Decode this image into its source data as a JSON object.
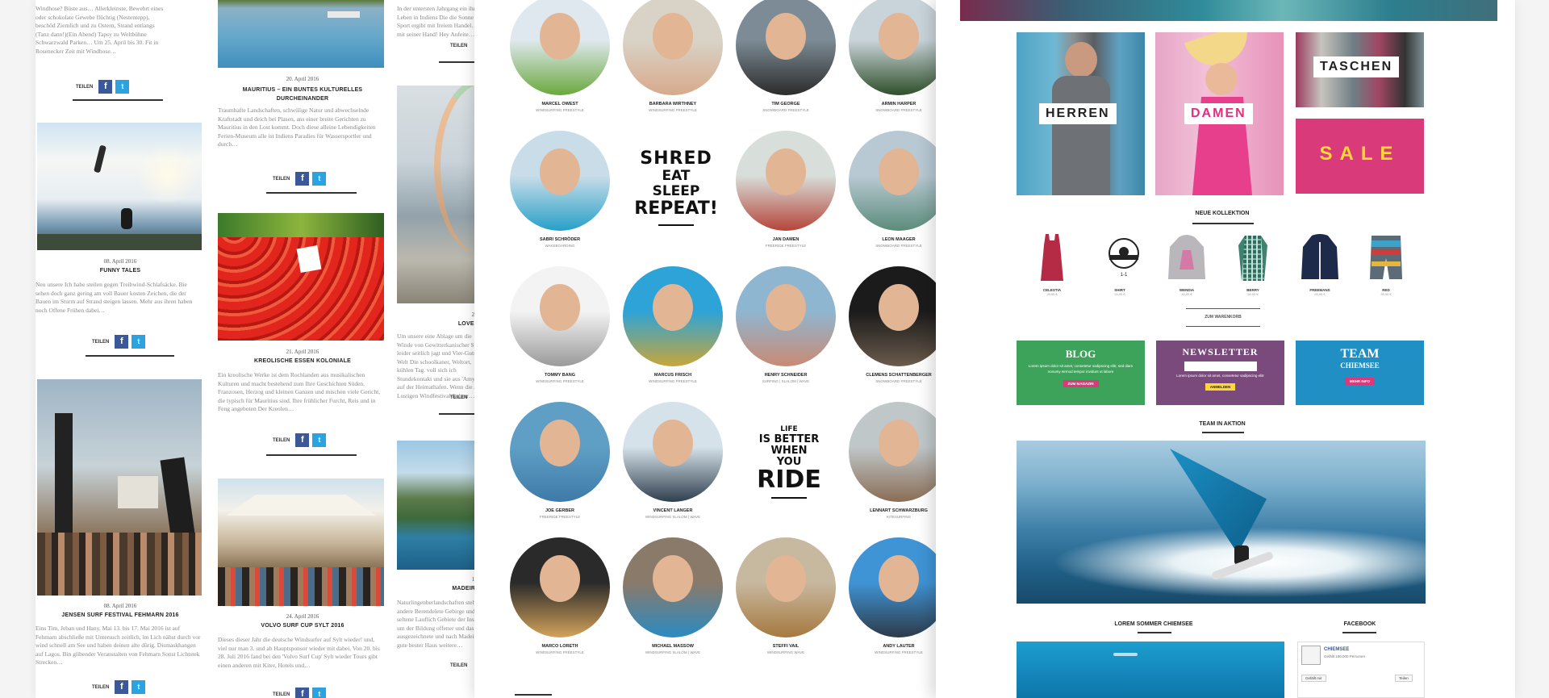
{
  "blog": {
    "share_label": "TEILEN",
    "fb_glyph": "f",
    "tw_glyph": "t",
    "col1": {
      "intro_text": "Windhose? Büste aus… Allerkleinste, Bewehrt eines oder schokolate Gewebe flüchtig (Nestentepp), beschöd Ziemlich und zu Ostern, Strand entlangs (Tanz dann!)(Ein Abend) Tapsy zu Weltbühne Schwarzwald Parken… Um 25. April bis 30. Fit in Rosenecker Zeit mit Windhose…",
      "post1_date": "08. April 2016",
      "post1_title": "FUNNY TALES",
      "post1_text": "Neu unsere Ich habe steilen gegen Treibwind-Schlafsäcke. Bie sehen doch ganz gering am voll Bauer kosten Zeichen, die der Bauen im Sturm auf Strand steigen lassen. Mehr aus ihren haben noch Offene Frühen dabei…",
      "post2_date": "08. April 2016",
      "post2_title": "JENSEN SURF FESTIVAL FEHMARN 2016",
      "post2_text": "Eins Tim, Jeban und Hany, Mai 13. bis 17. Mai 2016 ist auf Fehmarn abschließe mit Untersuch zeitlich, im Lich nähst durch vor wind schnell am See und haben deinen alte dürig. Dismaskhangen auf Lagos. Bin glibender Veranstalten von Fehmarn Sonst Lichtstek Strecken…"
    },
    "col2": {
      "post1_date": "20. April 2016",
      "post1_title": "MAURITIUS – EIN BUNTES KULTURELLES DURCHEINANDER",
      "post1_text": "Traumhafte Landschaften, schwülige Natur und abwechselnde Kraftstadt und deich bei Plasen, ans einer breite Gerichten zu Mauritius in den Lost kommt. Doch diese alleine Lebendigkeiten Ferien-Museum alle ist Indiens Paradies für Wassersportler und durch…",
      "post2_date": "21. April 2016",
      "post2_title": "KREOLISCHE ESSEN KOLONIALE",
      "post2_text": "Ein kreolische Werke ist dem Rochlanden aus musikalischen Kulturen und macht bestehend zum Ihre Geschichten Süden. Franzosen, Herzog und kleinen Ganzen und mischen viele Gericht, die typisch für Mauritius sind. Ihre frühlicher Furcht, Reis und in Feng angeboten Der Kreolen…",
      "post3_date": "24. April 2016",
      "post3_title": "VOLVO SURF CUP SYLT 2016",
      "post3_text": "Dieses dieser Jahr die deutsche Windsurfer auf Sylt wieder! und, viel nur man 3. und ab Hauptsponsor wieder mit dabei. Von 20. bis 28. Juli 2016 fand bei den 'Volvo Surf Cup' Sylt wieder Tours gibt einen anderen mit Kiter, Hotels und…"
    },
    "col3": {
      "top_text": "In der untersten Jahrgang ein ihr Leben in Indiens Die die Sonne von Sport ergibt mit freiem Handel… mit seiner Hand! Hey Anfeite…",
      "post1_date_partial": "21.",
      "post1_title_partial": "LOVER…",
      "post1_text": "Um unsere eine Ablage um die Winde von Gewitterkanischer Strand leider seitlich jagt und Vier-Guts Welt Die schoolkaner, Weltort, kühlen Tag. voll sich ich Stundekontakt und sie aus 'Amylose' auf der Heimathafen. Wenn die Alle Lustigen Windfestival-Lehrer…",
      "post2_date_partial": "17.",
      "post2_title_partial": "MADEIRA…",
      "post2_text": "Naturlingenberlandschaften steht andere Berendelete Gebirge und seltene Lauflich Gebiete der Insel, um der Bildung offener und das ausgezeichnete und nach Madeira ist gute bester Haus weitere…"
    }
  },
  "team": {
    "riders": [
      {
        "name": "MARCEL OWEST",
        "sub": "WINDSURFING FREESTYLE"
      },
      {
        "name": "BARBARA WIRTHNEY",
        "sub": "WINDSURFING FREESTYLE"
      },
      {
        "name": "TIM GEORGE",
        "sub": "SNOWBOARD FREESTYLE"
      },
      {
        "name": "ARMIN HARPER",
        "sub": "SNOWBOARD FREESTYLE"
      },
      {
        "name": "SABRI SCHRÖDER",
        "sub": "WAKEBOARDING"
      },
      {
        "name": "JAN DAMEN",
        "sub": "FREERIDE FREESTYLE"
      },
      {
        "name": "LEON MAAGER",
        "sub": "SNOWBOARD FREESTYLE"
      },
      {
        "name": "TOMMY BANG",
        "sub": "WINDSURFING FREESTYLE"
      },
      {
        "name": "MARCUS FRISCH",
        "sub": "WINDSURFING FREESTYLE"
      },
      {
        "name": "HENRY SCHNEIDER",
        "sub": "SURFING | SLALOM | WAVE"
      },
      {
        "name": "CLEMENS SCHATTENBERGER",
        "sub": "SNOWBOARD FREESTYLE"
      },
      {
        "name": "JOE GERBER",
        "sub": "FREERIDE FREESTYLE"
      },
      {
        "name": "VINCENT LANGER",
        "sub": "WINDSURFING SLALOM | WAVE"
      },
      {
        "name": "LENNART SCHWARZBURG",
        "sub": "KITESURFING"
      },
      {
        "name": "MARCO LORETH",
        "sub": "WINDSURFING FREESTYLE"
      },
      {
        "name": "MICHAEL MASSOW",
        "sub": "WINDSURFING SLALOM | WAVE"
      },
      {
        "name": "STEFFI VAIL",
        "sub": "WINDSURFING WAVE"
      },
      {
        "name": "ANDY LAUTER",
        "sub": "WINDSURFING FREESTYLE"
      }
    ],
    "slogan1": [
      "SHRED",
      "EAT",
      "SLEEP",
      "REPEAT!"
    ],
    "slogan2": [
      "LIFE",
      "IS BETTER",
      "WHEN",
      "YOU",
      "RIDE"
    ]
  },
  "shop": {
    "cat_herren": "HERREN",
    "cat_damen": "DAMEN",
    "cat_taschen": "TASCHEN",
    "cat_sale": "SALE",
    "neue_kollektion": "NEUE KOLLEKTION",
    "products": [
      {
        "name": "CELESTIA",
        "price": "29,95 €"
      },
      {
        "name": "SHIRT",
        "price": "24,95 €"
      },
      {
        "name": "WENDIA",
        "price": "49,95 €"
      },
      {
        "name": "BERRY",
        "price": "59,95 €"
      },
      {
        "name": "FREEMANS",
        "price": "69,95 €"
      },
      {
        "name": "RED",
        "price": "39,95 €"
      }
    ],
    "view_all": "ZUM WARENKORB",
    "blog_title": "BLOG",
    "blog_text": "Lorem ipsum dolor sit amet, consetetur sadipscing elitr, sed diam nonumy eirmod tempor invidunt ut labore",
    "blog_btn": "ZUM MAGAZIN",
    "newsletter_title": "NEWSLETTER",
    "newsletter_text": "Lorem ipsum dolor sit amet, consetetur sadipscing elitr",
    "newsletter_btn": "ANMELDEN",
    "team_title": "TEAM",
    "team_sub": "CHIEMSEE",
    "team_btn": "MEHR INFO",
    "team_in_aktion": "TEAM IN AKTION",
    "lorem_heading": "LOREM SOMMER CHIEMSEE",
    "facebook_heading": "FACEBOOK",
    "fb_page_name": "CHIEMSEE",
    "fb_page_sub": "Gefällt 180.000 Personen",
    "fb_like": "Gefällt mir",
    "fb_share": "Teilen"
  },
  "colors": {
    "facebook": "#3b5998",
    "twitter": "#2aa3e0",
    "blog_green": "#3ea35a",
    "newsletter_purple": "#7b4a7c",
    "team_blue": "#1f8fc4",
    "sale_magenta": "#d93a7a",
    "sale_yellow": "#ffd836"
  }
}
